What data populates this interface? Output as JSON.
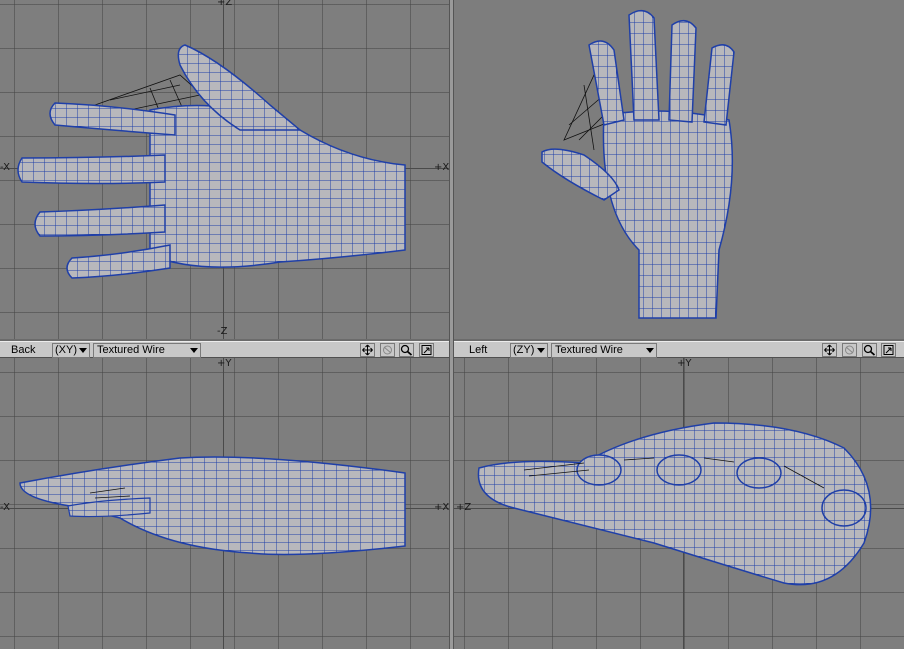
{
  "viewports": {
    "top": {
      "axis_labels": {
        "top": "+Z",
        "bottom": "-Z",
        "left": "-X",
        "right": "+X"
      }
    },
    "back": {
      "view_name": "Back",
      "axes_mode": "(XY)",
      "render_mode": "Textured Wire",
      "axis_labels": {
        "top": "+Y",
        "left": "-X",
        "right": "+X"
      }
    },
    "left": {
      "view_name": "Left",
      "axes_mode": "(ZY)",
      "render_mode": "Textured Wire",
      "axis_labels": {
        "top": "+Y",
        "left": "+Z"
      }
    }
  },
  "toolbar_icons": [
    "move-view-icon",
    "rotate-view-icon",
    "zoom-icon",
    "maximize-icon"
  ],
  "colors": {
    "viewport_bg": "#7e7e7e",
    "mesh_fill": "#b8b8bc",
    "wire": "#1f3fa8",
    "titlebar": "#c8c8c8"
  }
}
